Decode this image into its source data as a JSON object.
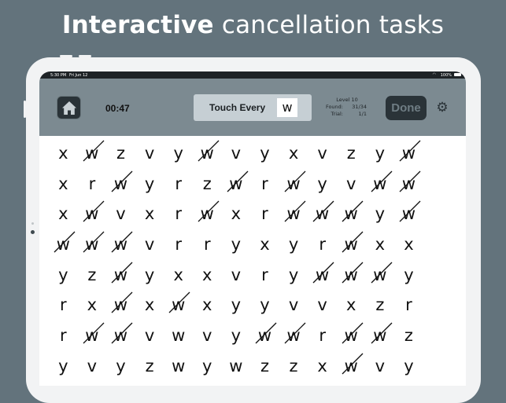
{
  "headline": {
    "bold": "Interactive",
    "rest": " cancellation tasks"
  },
  "statusbar": {
    "time": "5:30 PM",
    "date": "Fri Jun 12",
    "battery": "100%"
  },
  "toolbar": {
    "timer": "00:47",
    "touch_label": "Touch Every",
    "target_letter": "w",
    "level": "Level 10",
    "found_label": "Found:",
    "found_value": "31/34",
    "trial_label": "Trial:",
    "trial_value": "1/1",
    "done_label": "Done"
  },
  "icons": {
    "home": "home-icon",
    "gear": "gear-icon"
  },
  "colors": {
    "background": "#63737c",
    "toolbar": "#7c8a91",
    "button": "#2a3338",
    "touch_box": "#c6cfd4"
  },
  "grid": [
    [
      {
        "l": "x"
      },
      {
        "l": "w",
        "c": true
      },
      {
        "l": "z"
      },
      {
        "l": "v"
      },
      {
        "l": "y"
      },
      {
        "l": "w",
        "c": true
      },
      {
        "l": "v"
      },
      {
        "l": "y"
      },
      {
        "l": "x"
      },
      {
        "l": "v"
      },
      {
        "l": "z"
      },
      {
        "l": "y"
      },
      {
        "l": "w",
        "c": true
      }
    ],
    [
      {
        "l": "x"
      },
      {
        "l": "r"
      },
      {
        "l": "w",
        "c": true
      },
      {
        "l": "y"
      },
      {
        "l": "r"
      },
      {
        "l": "z"
      },
      {
        "l": "w",
        "c": true
      },
      {
        "l": "r"
      },
      {
        "l": "w",
        "c": true
      },
      {
        "l": "y"
      },
      {
        "l": "v"
      },
      {
        "l": "w",
        "c": true
      },
      {
        "l": "w",
        "c": true
      }
    ],
    [
      {
        "l": "x"
      },
      {
        "l": "w",
        "c": true
      },
      {
        "l": "v"
      },
      {
        "l": "x"
      },
      {
        "l": "r"
      },
      {
        "l": "w",
        "c": true
      },
      {
        "l": "x"
      },
      {
        "l": "r"
      },
      {
        "l": "w",
        "c": true
      },
      {
        "l": "w",
        "c": true
      },
      {
        "l": "w",
        "c": true
      },
      {
        "l": "y"
      },
      {
        "l": "w",
        "c": true
      }
    ],
    [
      {
        "l": "w",
        "c": true
      },
      {
        "l": "w",
        "c": true
      },
      {
        "l": "w",
        "c": true
      },
      {
        "l": "v"
      },
      {
        "l": "r"
      },
      {
        "l": "r"
      },
      {
        "l": "y"
      },
      {
        "l": "x"
      },
      {
        "l": "y"
      },
      {
        "l": "r"
      },
      {
        "l": "w",
        "c": true
      },
      {
        "l": "x"
      },
      {
        "l": "x"
      }
    ],
    [
      {
        "l": "y"
      },
      {
        "l": "z"
      },
      {
        "l": "w",
        "c": true
      },
      {
        "l": "y"
      },
      {
        "l": "x"
      },
      {
        "l": "x"
      },
      {
        "l": "v"
      },
      {
        "l": "r"
      },
      {
        "l": "y"
      },
      {
        "l": "w",
        "c": true
      },
      {
        "l": "w",
        "c": true
      },
      {
        "l": "w",
        "c": true
      },
      {
        "l": "y"
      }
    ],
    [
      {
        "l": "r"
      },
      {
        "l": "x"
      },
      {
        "l": "w",
        "c": true
      },
      {
        "l": "x"
      },
      {
        "l": "w",
        "c": true
      },
      {
        "l": "x"
      },
      {
        "l": "y"
      },
      {
        "l": "y"
      },
      {
        "l": "v"
      },
      {
        "l": "v"
      },
      {
        "l": "x"
      },
      {
        "l": "z"
      },
      {
        "l": "r"
      }
    ],
    [
      {
        "l": "r"
      },
      {
        "l": "w",
        "c": true
      },
      {
        "l": "w",
        "c": true
      },
      {
        "l": "v"
      },
      {
        "l": "w"
      },
      {
        "l": "v"
      },
      {
        "l": "y"
      },
      {
        "l": "w",
        "c": true
      },
      {
        "l": "w",
        "c": true
      },
      {
        "l": "r"
      },
      {
        "l": "w",
        "c": true
      },
      {
        "l": "w",
        "c": true
      },
      {
        "l": "z"
      }
    ],
    [
      {
        "l": "y"
      },
      {
        "l": "v"
      },
      {
        "l": "y"
      },
      {
        "l": "z"
      },
      {
        "l": "w"
      },
      {
        "l": "y"
      },
      {
        "l": "w"
      },
      {
        "l": "z"
      },
      {
        "l": "z"
      },
      {
        "l": "x"
      },
      {
        "l": "w",
        "c": true
      },
      {
        "l": "v"
      },
      {
        "l": "y"
      }
    ]
  ]
}
